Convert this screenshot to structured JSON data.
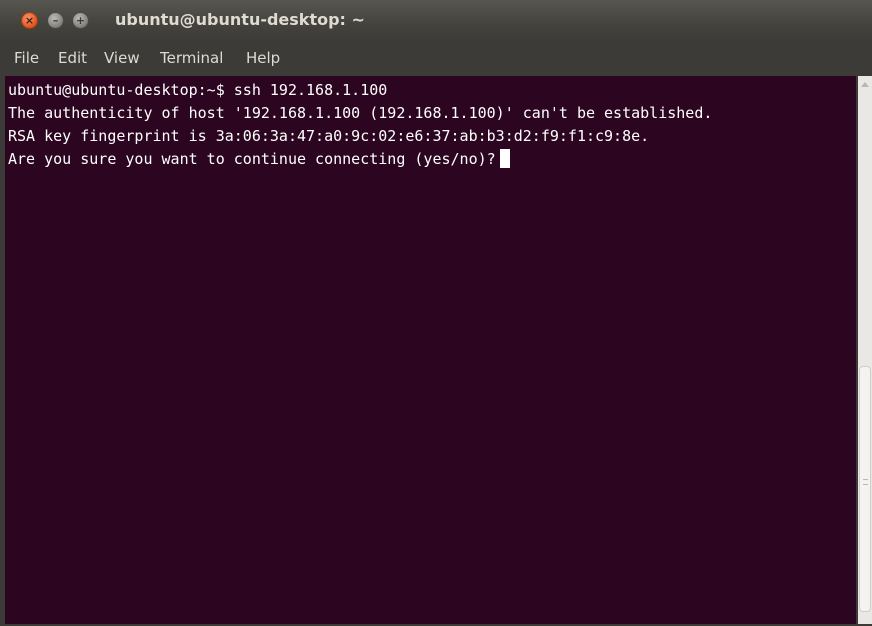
{
  "window": {
    "title": "ubuntu@ubuntu-desktop: ~",
    "close_glyph": "×",
    "minimize_glyph": "–",
    "maximize_glyph": "+"
  },
  "menu": {
    "items": [
      "File",
      "Edit",
      "View",
      "Terminal",
      "Help"
    ]
  },
  "terminal": {
    "lines": [
      "ubuntu@ubuntu-desktop:~$ ssh 192.168.1.100",
      "The authenticity of host '192.168.1.100 (192.168.1.100)' can't be established.",
      "RSA key fingerprint is 3a:06:3a:47:a0:9c:02:e6:37:ab:b3:d2:f9:f1:c9:8e.",
      "Are you sure you want to continue connecting (yes/no)?"
    ]
  },
  "colors": {
    "terminal_background": "#2c0620",
    "terminal_text": "#ffffff",
    "titlebar": "#3c3b37",
    "close_button": "#e0541f"
  },
  "icons": [
    "close-icon",
    "minimize-icon",
    "maximize-icon"
  ]
}
